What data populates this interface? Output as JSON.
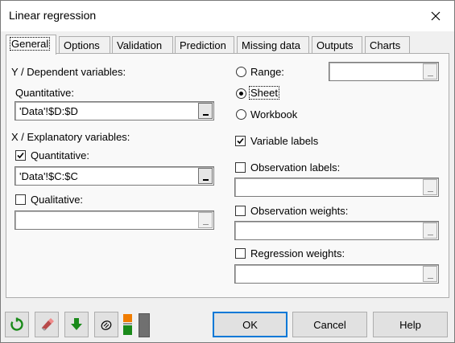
{
  "window": {
    "title": "Linear regression"
  },
  "tabs": [
    {
      "label": "General",
      "active": true
    },
    {
      "label": "Options"
    },
    {
      "label": "Validation"
    },
    {
      "label": "Prediction"
    },
    {
      "label": "Missing data"
    },
    {
      "label": "Outputs"
    },
    {
      "label": "Charts"
    }
  ],
  "general": {
    "y_section_label": "Y / Dependent variables:",
    "y_quantitative_label": "Quantitative:",
    "y_quantitative_value": "'Data'!$D:$D",
    "x_section_label": "X / Explanatory variables:",
    "x_quantitative_label": "Quantitative:",
    "x_quantitative_checked": true,
    "x_quantitative_value": "'Data'!$C:$C",
    "x_qualitative_label": "Qualitative:",
    "x_qualitative_checked": false,
    "x_qualitative_value": "",
    "output_options": [
      {
        "label": "Range:",
        "selected": false
      },
      {
        "label": "Sheet",
        "selected": true
      },
      {
        "label": "Workbook",
        "selected": false
      }
    ],
    "range_value": "",
    "variable_labels": {
      "label": "Variable labels",
      "checked": true
    },
    "observation_labels": {
      "label": "Observation labels:",
      "checked": false,
      "value": ""
    },
    "observation_weights": {
      "label": "Observation weights:",
      "checked": false,
      "value": ""
    },
    "regression_weights": {
      "label": "Regression weights:",
      "checked": false,
      "value": ""
    }
  },
  "toolbar_icons": [
    "reset-icon",
    "eraser-icon",
    "download-arrow-icon",
    "cursor-icon",
    "layout-toggle-icon"
  ],
  "buttons": {
    "ok": "OK",
    "cancel": "Cancel",
    "help": "Help"
  },
  "colors": {
    "accent_border": "#0078d7",
    "green_icon": "#1a8a1a",
    "orange_icon": "#f07c00"
  }
}
